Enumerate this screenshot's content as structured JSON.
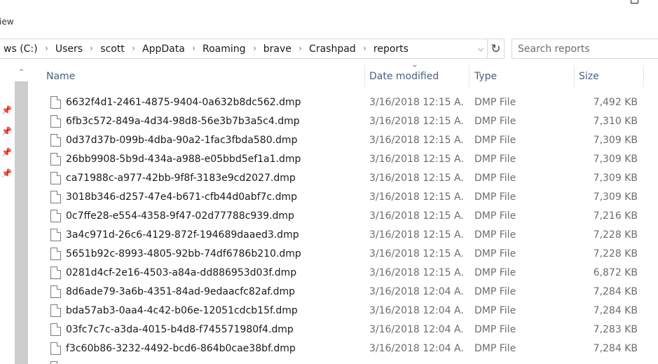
{
  "ribbon": {
    "tab_view": "iew"
  },
  "address": {
    "crumbs": [
      "ws (C:)",
      "Users",
      "scott",
      "AppData",
      "Roaming",
      "brave",
      "Crashpad",
      "reports"
    ],
    "separator": "›"
  },
  "search": {
    "placeholder": "Search reports"
  },
  "columns": {
    "name": "Name",
    "date": "Date modified",
    "type": "Type",
    "size": "Size"
  },
  "icons": {
    "dropdown": "⌵",
    "refresh": "↻",
    "scroll_up": "^",
    "pin": "📌",
    "sort": "⌄"
  },
  "files": [
    {
      "name": "6632f4d1-2461-4875-9404-0a632b8dc562.dmp",
      "date": "3/16/2018 12:15 A...",
      "type": "DMP File",
      "size": "7,492 KB"
    },
    {
      "name": "6fb3c572-849a-4d34-98d8-56e3b7b3a5c4.dmp",
      "date": "3/16/2018 12:15 A...",
      "type": "DMP File",
      "size": "7,310 KB"
    },
    {
      "name": "0d37d37b-099b-4dba-90a2-1fac3fbda580.dmp",
      "date": "3/16/2018 12:15 A...",
      "type": "DMP File",
      "size": "7,309 KB"
    },
    {
      "name": "26bb9908-5b9d-434a-a988-e05bbd5ef1a1.dmp",
      "date": "3/16/2018 12:15 A...",
      "type": "DMP File",
      "size": "7,309 KB"
    },
    {
      "name": "ca71988c-a977-42bb-9f8f-3183e9cd2027.dmp",
      "date": "3/16/2018 12:15 A...",
      "type": "DMP File",
      "size": "7,309 KB"
    },
    {
      "name": "3018b346-d257-47e4-b671-cfb44d0abf7c.dmp",
      "date": "3/16/2018 12:15 A...",
      "type": "DMP File",
      "size": "7,309 KB"
    },
    {
      "name": "0c7ffe28-e554-4358-9f47-02d77788c939.dmp",
      "date": "3/16/2018 12:15 A...",
      "type": "DMP File",
      "size": "7,216 KB"
    },
    {
      "name": "3a4c971d-26c6-4129-872f-194689daaed3.dmp",
      "date": "3/16/2018 12:15 A...",
      "type": "DMP File",
      "size": "7,228 KB"
    },
    {
      "name": "5651b92c-8993-4805-92bb-74df6786b210.dmp",
      "date": "3/16/2018 12:15 A...",
      "type": "DMP File",
      "size": "7,228 KB"
    },
    {
      "name": "0281d4cf-2e16-4503-a84a-dd886953d03f.dmp",
      "date": "3/16/2018 12:15 A...",
      "type": "DMP File",
      "size": "6,872 KB"
    },
    {
      "name": "8d6ade79-3a6b-4351-84ad-9edaacfc82af.dmp",
      "date": "3/16/2018 12:04 A...",
      "type": "DMP File",
      "size": "7,284 KB"
    },
    {
      "name": "bda57ab3-0aa4-4c42-b06e-12051cdcb15f.dmp",
      "date": "3/16/2018 12:04 A...",
      "type": "DMP File",
      "size": "7,284 KB"
    },
    {
      "name": "03fc7c7c-a3da-4015-b4d8-f745571980f4.dmp",
      "date": "3/16/2018 12:04 A...",
      "type": "DMP File",
      "size": "7,283 KB"
    },
    {
      "name": "f3c60b86-3232-4492-bcd6-864b0cae38bf.dmp",
      "date": "3/16/2018 12:04 A...",
      "type": "DMP File",
      "size": "7,284 KB"
    }
  ]
}
